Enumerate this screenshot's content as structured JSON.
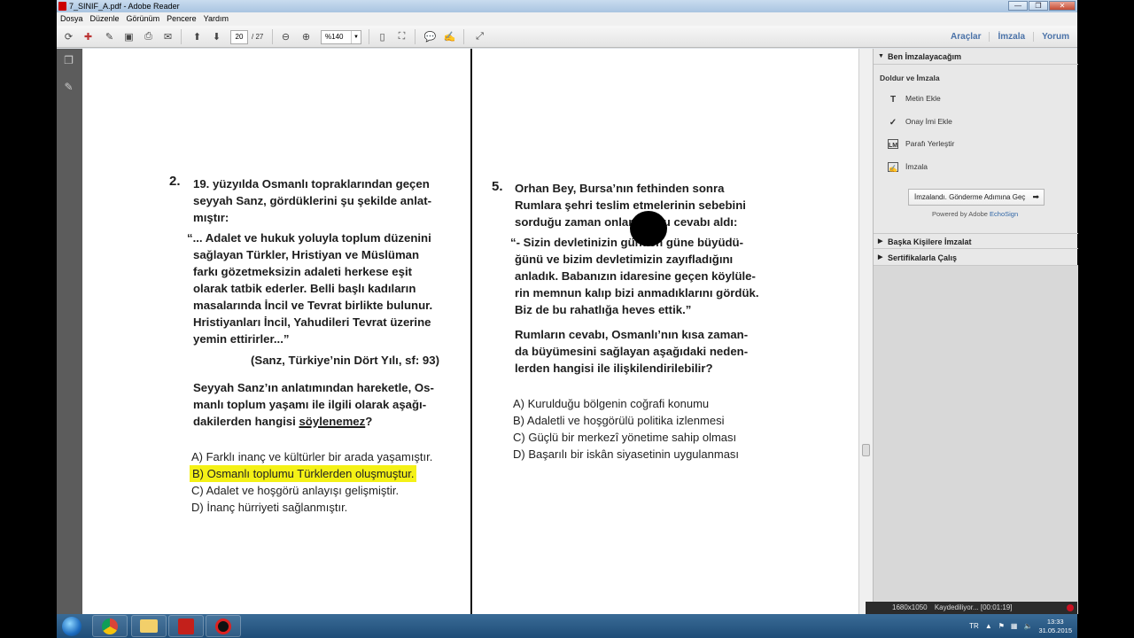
{
  "window": {
    "title": "7_SINIF_A.pdf - Adobe Reader"
  },
  "menu": [
    "Dosya",
    "Düzenle",
    "Görünüm",
    "Pencere",
    "Yardım"
  ],
  "toolbar": {
    "page_current": "20",
    "page_total": "/ 27",
    "zoom": "%140",
    "links": [
      "Araçlar",
      "İmzala",
      "Yorum"
    ]
  },
  "left_page": {
    "q_number": "2.",
    "q_lines": [
      "19. yüzyılda Osmanlı topraklarından geçen",
      "seyyah Sanz, gördüklerini şu şekilde anlat-",
      "mıştır:"
    ],
    "quote_lines": [
      "“... Adalet ve hukuk yoluyla toplum düzenini",
      "sağlayan Türkler, Hristiyan ve Müslüman",
      "farkı gözetmeksizin adaleti herkese eşit",
      "olarak tatbik ederler. Belli başlı kadıların",
      "masalarında İncil ve Tevrat birlikte bulunur.",
      "Hristiyanları İncil, Yahudileri Tevrat üzerine",
      "yemin ettirirler...”"
    ],
    "source": "(Sanz, Türkiye’nin Dört Yılı, sf: 93)",
    "ask_lines": [
      "Seyyah Sanz’ın anlatımından hareketle, Os-",
      "manlı toplum yaşamı ile ilgili olarak aşağı-",
      "dakilerden hangisi "
    ],
    "ask_underlined": "söylenemez",
    "ask_end": "?",
    "options": [
      "A) Farklı inanç ve kültürler bir arada yaşamıştır.",
      "B) Osmanlı toplumu Türklerden oluşmuştur.",
      "C) Adalet ve hoşgörü anlayışı gelişmiştir.",
      "D) İnanç hürriyeti sağlanmıştır."
    ]
  },
  "right_page": {
    "q_number": "5.",
    "q_lines": [
      "Orhan Bey, Bursa’nın fethinden sonra",
      "Rumlara şehri teslim etmelerinin sebebini",
      "sorduğu zaman onlardan şu cevabı aldı:"
    ],
    "quote_lines": [
      "“- Sizin devletinizin günden güne büyüdü-",
      "ğünü ve bizim devletimizin zayıfladığını",
      "anladık. Babanızın idaresine geçen köylüle-",
      "rin memnun kalıp bizi anmadıklarını gördük.",
      "Biz de bu rahatlığa heves ettik.”"
    ],
    "ask_lines": [
      "Rumların cevabı, Osmanlı’nın kısa zaman-",
      "da büyümesini sağlayan aşağıdaki neden-",
      "lerden hangisi ile ilişkilendirilebilir?"
    ],
    "options": [
      "A) Kurulduğu bölgenin coğrafi konumu",
      "B) Adaletli ve hoşgörülü politika izlenmesi",
      "C) Güçlü bir merkezî yönetime sahip olması",
      "D) Başarılı bir iskân siyasetinin uygulanması"
    ]
  },
  "right_panel": {
    "section1": "Ben İmzalayacağım",
    "fill_sign": "Doldur ve İmzala",
    "items": [
      "Metin Ekle",
      "Onay İmi Ekle",
      "Parafı Yerleştir",
      "İmzala"
    ],
    "send_button": "İmzalandı. Gönderme Adımına Geç",
    "powered": "Powered by Adobe ",
    "echosign": "EchoSign",
    "section2": "Başka Kişilere İmzalat",
    "section3": "Sertifikalarla Çalış"
  },
  "recorder": {
    "resolution": "1680x1050",
    "status": "Kaydediliyor... [00:01:19]"
  },
  "taskbar": {
    "lang": "TR",
    "time": "13:33",
    "date": "31.05.2015"
  }
}
